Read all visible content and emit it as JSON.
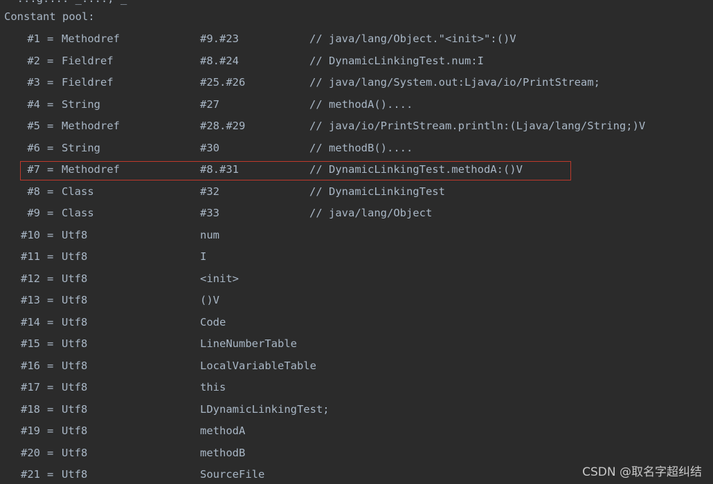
{
  "console": {
    "cut_line": "  ...g...: _...., _",
    "header": "Constant pool:",
    "highlight_color": "#c0392b",
    "text_color": "#a9b7c6",
    "background": "#2b2b2b"
  },
  "entries": [
    {
      "index": "#1",
      "eq": "=",
      "type": "Methodref",
      "ref": "#9.#23",
      "comment": "// java/lang/Object.\"<init>\":()V"
    },
    {
      "index": "#2",
      "eq": "=",
      "type": "Fieldref",
      "ref": "#8.#24",
      "comment": "// DynamicLinkingTest.num:I"
    },
    {
      "index": "#3",
      "eq": "=",
      "type": "Fieldref",
      "ref": "#25.#26",
      "comment": "// java/lang/System.out:Ljava/io/PrintStream;"
    },
    {
      "index": "#4",
      "eq": "=",
      "type": "String",
      "ref": "#27",
      "comment": "// methodA()...."
    },
    {
      "index": "#5",
      "eq": "=",
      "type": "Methodref",
      "ref": "#28.#29",
      "comment": "// java/io/PrintStream.println:(Ljava/lang/String;)V"
    },
    {
      "index": "#6",
      "eq": "=",
      "type": "String",
      "ref": "#30",
      "comment": "// methodB()...."
    },
    {
      "index": "#7",
      "eq": "=",
      "type": "Methodref",
      "ref": "#8.#31",
      "comment": "// DynamicLinkingTest.methodA:()V"
    },
    {
      "index": "#8",
      "eq": "=",
      "type": "Class",
      "ref": "#32",
      "comment": "// DynamicLinkingTest"
    },
    {
      "index": "#9",
      "eq": "=",
      "type": "Class",
      "ref": "#33",
      "comment": "// java/lang/Object"
    },
    {
      "index": "#10",
      "eq": "=",
      "type": "Utf8",
      "ref": "num",
      "comment": ""
    },
    {
      "index": "#11",
      "eq": "=",
      "type": "Utf8",
      "ref": "I",
      "comment": ""
    },
    {
      "index": "#12",
      "eq": "=",
      "type": "Utf8",
      "ref": "<init>",
      "comment": ""
    },
    {
      "index": "#13",
      "eq": "=",
      "type": "Utf8",
      "ref": "()V",
      "comment": ""
    },
    {
      "index": "#14",
      "eq": "=",
      "type": "Utf8",
      "ref": "Code",
      "comment": ""
    },
    {
      "index": "#15",
      "eq": "=",
      "type": "Utf8",
      "ref": "LineNumberTable",
      "comment": ""
    },
    {
      "index": "#16",
      "eq": "=",
      "type": "Utf8",
      "ref": "LocalVariableTable",
      "comment": ""
    },
    {
      "index": "#17",
      "eq": "=",
      "type": "Utf8",
      "ref": "this",
      "comment": ""
    },
    {
      "index": "#18",
      "eq": "=",
      "type": "Utf8",
      "ref": "LDynamicLinkingTest;",
      "comment": ""
    },
    {
      "index": "#19",
      "eq": "=",
      "type": "Utf8",
      "ref": "methodA",
      "comment": ""
    },
    {
      "index": "#20",
      "eq": "=",
      "type": "Utf8",
      "ref": "methodB",
      "comment": ""
    },
    {
      "index": "#21",
      "eq": "=",
      "type": "Utf8",
      "ref": "SourceFile",
      "comment": ""
    }
  ],
  "highlighted_entry": "#7",
  "watermark": "CSDN @取名字超纠结"
}
